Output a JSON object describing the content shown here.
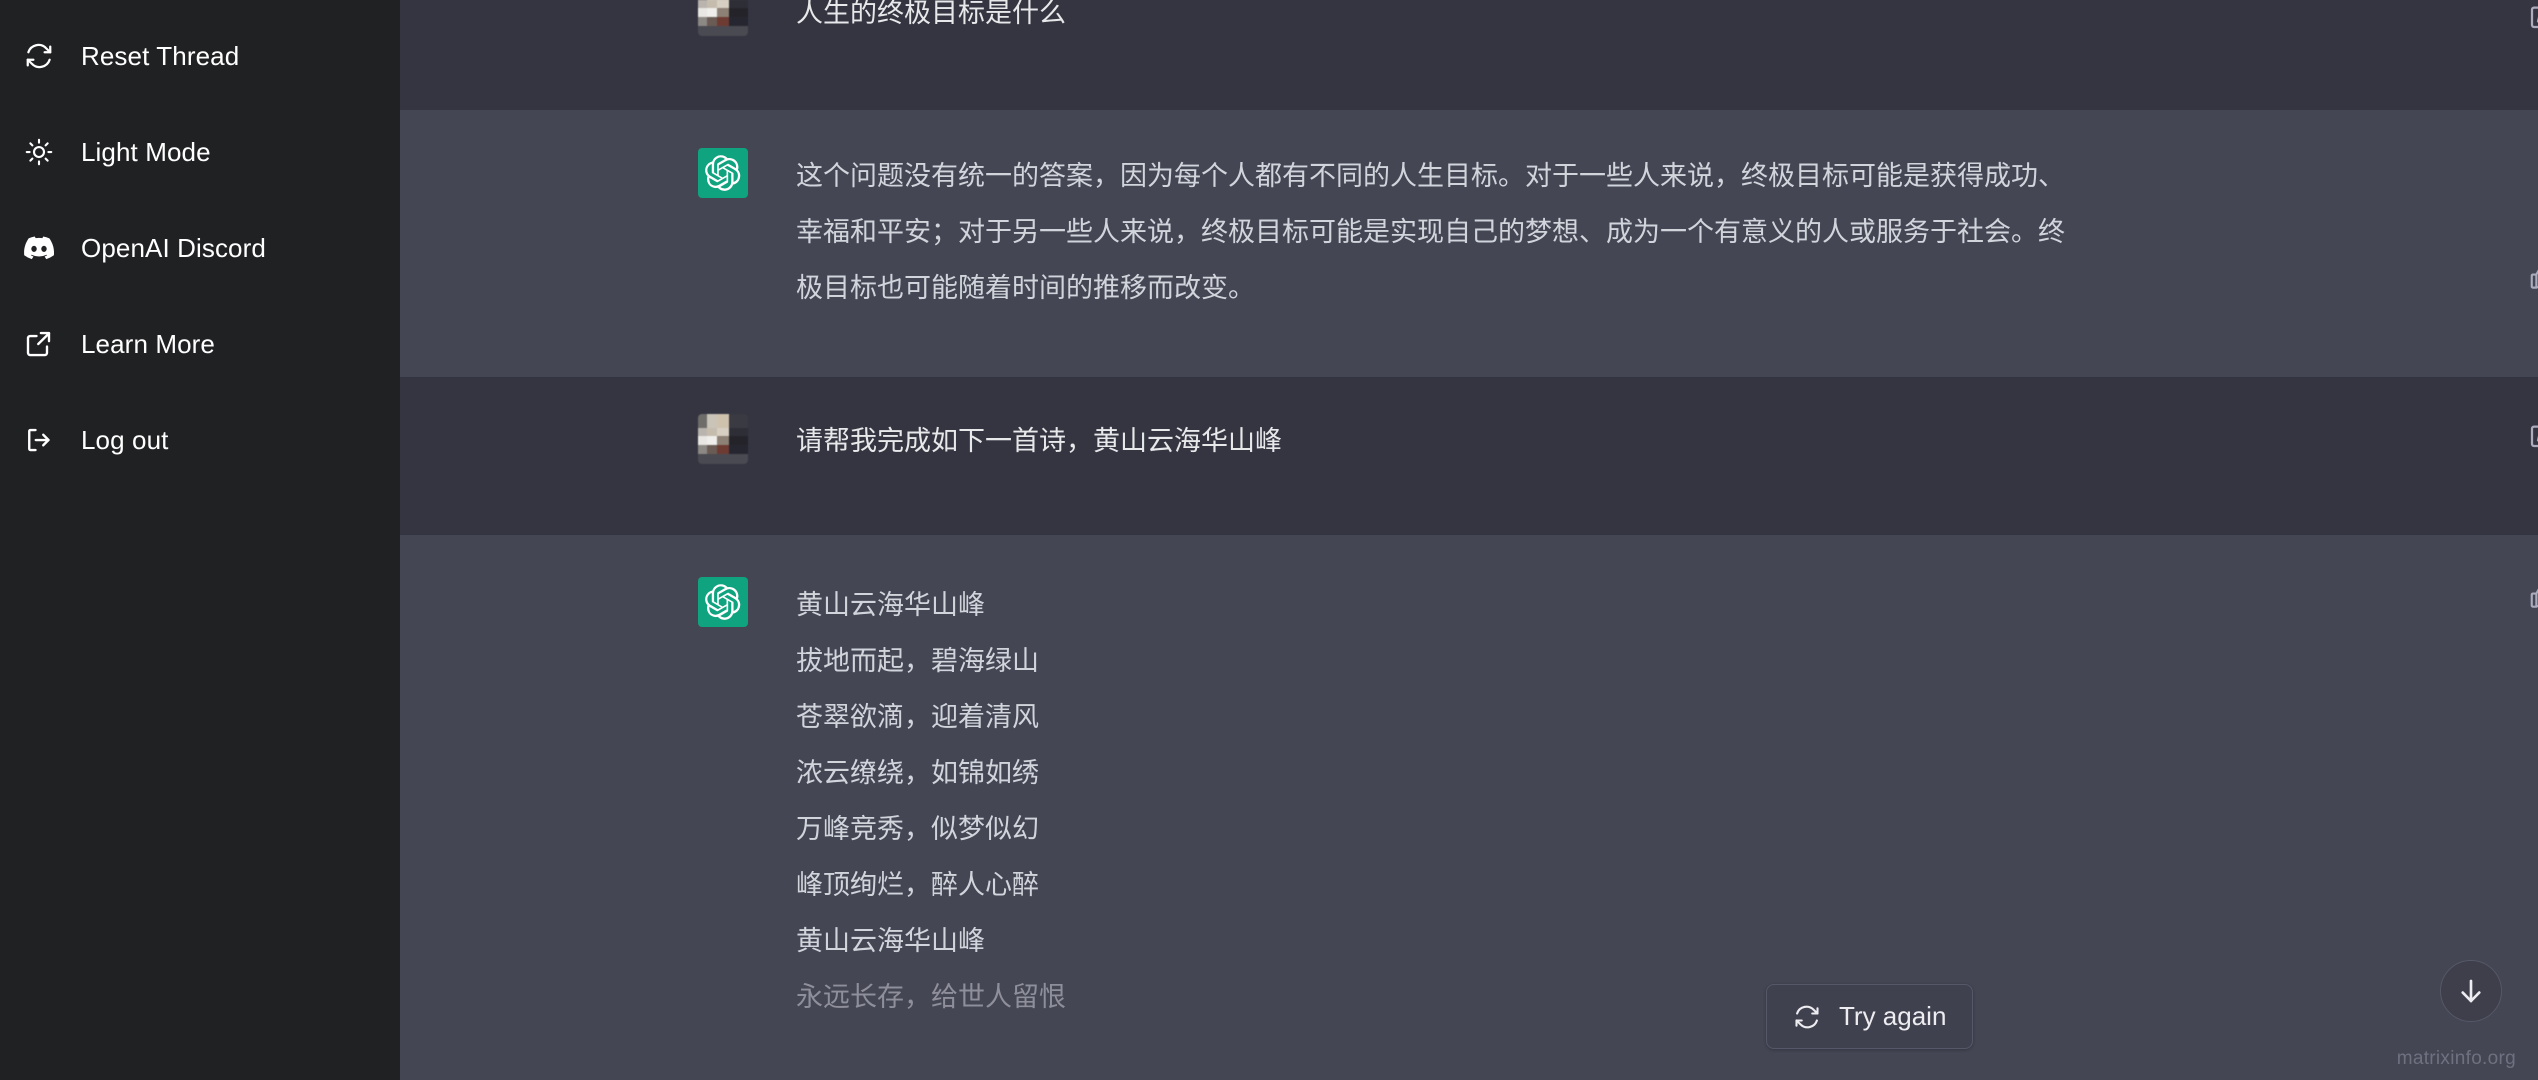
{
  "sidebar": {
    "items": [
      {
        "label": "Reset Thread",
        "icon": "reset-thread-icon"
      },
      {
        "label": "Light Mode",
        "icon": "sun-icon"
      },
      {
        "label": "OpenAI Discord",
        "icon": "discord-icon"
      },
      {
        "label": "Learn More",
        "icon": "external-link-icon"
      },
      {
        "label": "Log out",
        "icon": "logout-icon"
      }
    ]
  },
  "conversation": {
    "messages": [
      {
        "role": "user",
        "avatar": "user-avatar",
        "text": "人生的终极目标是什么",
        "actions": [
          "edit-icon"
        ]
      },
      {
        "role": "assistant",
        "avatar": "chatgpt-avatar",
        "text": "这个问题没有统一的答案，因为每个人都有不同的人生目标。对于一些人来说，终极目标可能是获得成功、幸福和平安；对于另一些人来说，终极目标可能是实现自己的梦想、成为一个有意义的人或服务于社会。终极目标也可能随着时间的推移而改变。",
        "actions": [
          "thumbs-up-icon",
          "thumbs-down-icon"
        ]
      },
      {
        "role": "user",
        "avatar": "user-avatar",
        "text": "请帮我完成如下一首诗，黄山云海华山峰",
        "actions": [
          "edit-icon"
        ]
      },
      {
        "role": "assistant",
        "avatar": "chatgpt-avatar",
        "actions": [
          "thumbs-up-icon",
          "thumbs-down-icon"
        ],
        "lines": [
          {
            "text": "黄山云海华山峰",
            "faded": false
          },
          {
            "text": "拔地而起，碧海绿山",
            "faded": false
          },
          {
            "text": "苍翠欲滴，迎着清风",
            "faded": false
          },
          {
            "text": "浓云缭绕，如锦如绣",
            "faded": false
          },
          {
            "text": "万峰竞秀，似梦似幻",
            "faded": false
          },
          {
            "text": "峰顶绚烂，醉人心醉",
            "faded": false
          },
          {
            "text": "黄山云海华山峰",
            "faded": false
          },
          {
            "text": "永远长存，给世人留恨",
            "faded": true
          }
        ]
      }
    ]
  },
  "try_again": {
    "label": "Try again",
    "icon": "refresh-icon"
  },
  "scroll_button": {
    "icon": "arrow-down-icon"
  },
  "watermark": {
    "text": "matrixinfo.org"
  },
  "colors": {
    "sidebar_bg": "#202123",
    "user_row_bg": "#343541",
    "assistant_row_bg": "#444654",
    "brand_green": "#10a37f",
    "text_primary": "#d1d5db",
    "icon_muted": "#acacbe"
  }
}
